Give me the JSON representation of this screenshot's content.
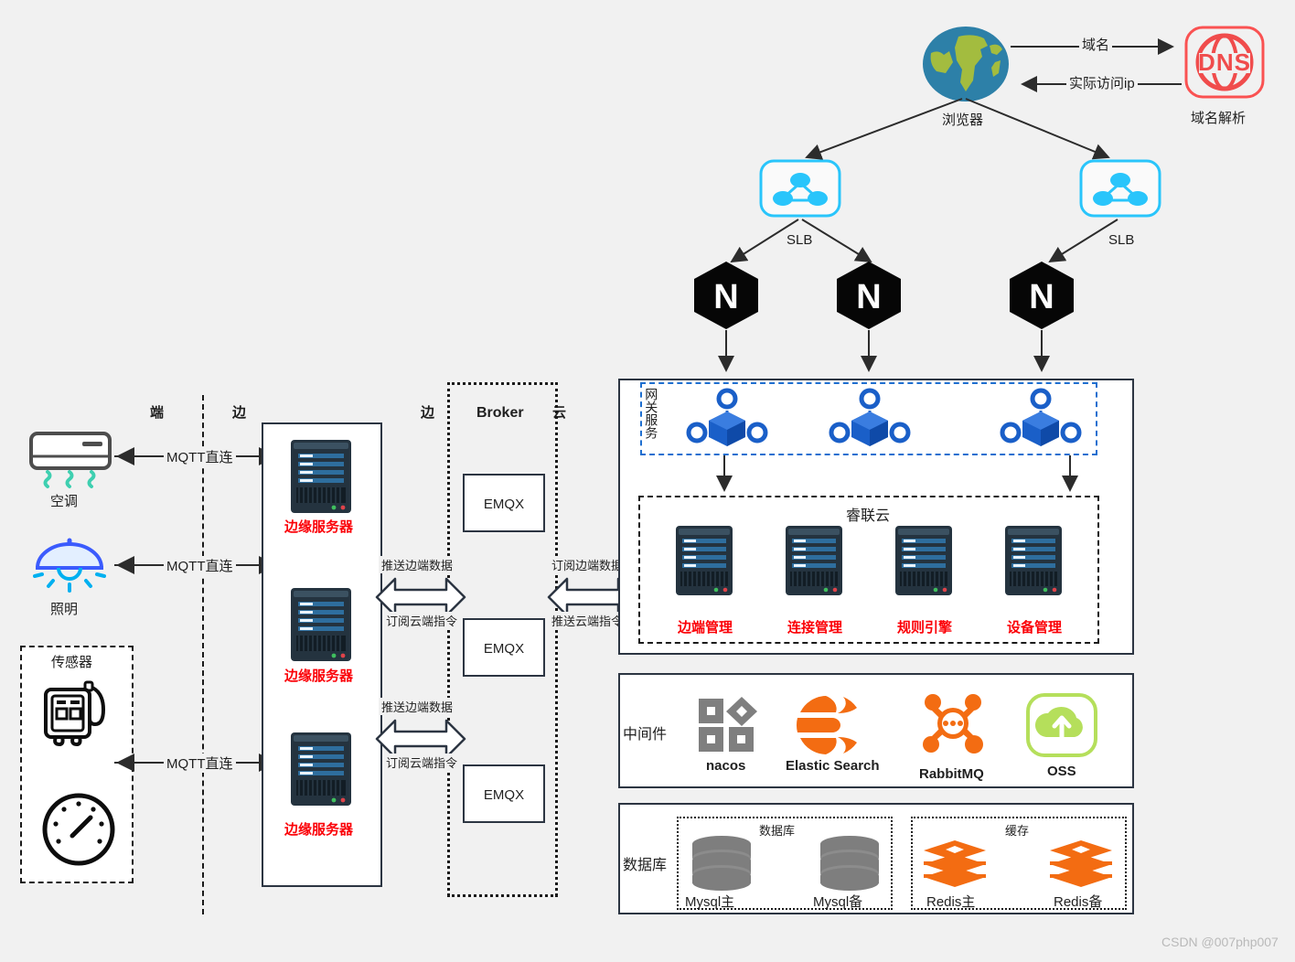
{
  "diagram": {
    "watermark": "CSDN @007php007",
    "colors": {
      "accent_red": "#fb0007",
      "accent_blue": "#1f6fd0",
      "slb_cyan": "#29c5fb",
      "dns_red": "#fa5252",
      "orange": "#f36c12",
      "globe_ocean": "#2d80a8",
      "globe_land": "#a3bc3f",
      "server_body": "#24333f",
      "server_bar": "#2e6e9e",
      "lamp_blue": "#3b5bfd",
      "lamp_ray": "#00b0f0",
      "ac_gray": "#4d4d4d",
      "ac_wave": "#3ecfb0"
    },
    "zone_labels": {
      "terminal": "端",
      "edge_left": "边",
      "edge_right": "边",
      "cloud": "云"
    },
    "top": {
      "browser_label": "浏览器",
      "browser_icon": "globe-icon",
      "dns_label": "域名解析",
      "dns_icon": "dns-globe-icon",
      "dns_text": "DNS",
      "arrow_to_dns": "域名",
      "arrow_from_dns": "实际访问ip",
      "slb_label_left": "SLB",
      "slb_label_right": "SLB",
      "slb_icon": "slb-node-icon",
      "nginx_icon": "nginx-icon",
      "nginx_letter": "N",
      "nginx_count": 3
    },
    "devices": [
      {
        "name": "空调",
        "icon": "air-conditioner-icon",
        "link": "MQTT直连"
      },
      {
        "name": "照明",
        "icon": "lamp-icon",
        "link": "MQTT直连"
      },
      {
        "name": "传感器",
        "icon": "sensor-group",
        "link": "MQTT直连",
        "children": [
          "sensor-device-icon",
          "gauge-icon"
        ]
      }
    ],
    "edge": {
      "servers": [
        {
          "label": "边缘服务器",
          "icon": "server-icon"
        },
        {
          "label": "边缘服务器",
          "icon": "server-icon"
        },
        {
          "label": "边缘服务器",
          "icon": "server-icon"
        }
      ]
    },
    "broker": {
      "title": "Broker",
      "nodes": [
        "EMQX",
        "EMQX",
        "EMQX"
      ],
      "arrows_left": [
        {
          "top": "推送边端数据",
          "bottom": "订阅云端指令"
        },
        {
          "top": "推送边端数据",
          "bottom": "订阅云端指令"
        }
      ],
      "arrows_right": [
        {
          "top": "订阅边端数据",
          "bottom": "推送云端指令"
        }
      ]
    },
    "cloud": {
      "gateway": {
        "label": "网关服务",
        "icon": "gateway-node-icon",
        "count": 3
      },
      "ruilian": {
        "title": "睿联云",
        "services": [
          {
            "label": "边端管理",
            "icon": "server-icon"
          },
          {
            "label": "连接管理",
            "icon": "server-icon"
          },
          {
            "label": "规则引擎",
            "icon": "server-icon"
          },
          {
            "label": "设备管理",
            "icon": "server-icon"
          }
        ]
      },
      "middleware": {
        "title": "中间件",
        "items": [
          {
            "label": "nacos",
            "icon": "nacos-icon"
          },
          {
            "label": "Elastic Search",
            "icon": "elasticsearch-icon"
          },
          {
            "label": "RabbitMQ",
            "icon": "rabbitmq-icon"
          },
          {
            "label": "OSS",
            "icon": "oss-icon"
          }
        ]
      },
      "database": {
        "title": "数据库",
        "groups": [
          {
            "title": "数据库",
            "items": [
              {
                "label": "Mysql主",
                "icon": "database-cylinder-icon"
              },
              {
                "label": "Mysql备",
                "icon": "database-cylinder-icon"
              }
            ]
          },
          {
            "title": "缓存",
            "items": [
              {
                "label": "Redis主",
                "icon": "redis-icon"
              },
              {
                "label": "Redis备",
                "icon": "redis-icon"
              }
            ]
          }
        ]
      }
    }
  }
}
